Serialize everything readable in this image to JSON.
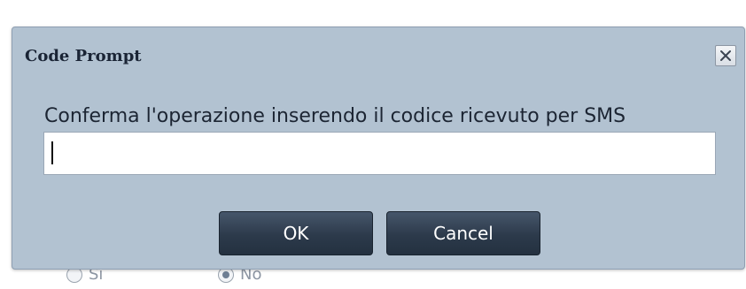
{
  "dialog": {
    "title": "Code Prompt",
    "close_icon": "close-icon",
    "prompt_label": "Conferma l'operazione inserendo il codice ricevuto per SMS",
    "input_value": "",
    "ok_label": "OK",
    "cancel_label": "Cancel"
  },
  "background": {
    "radio_options": [
      {
        "label": "Sì",
        "selected": false
      },
      {
        "label": "No",
        "selected": true
      }
    ]
  }
}
